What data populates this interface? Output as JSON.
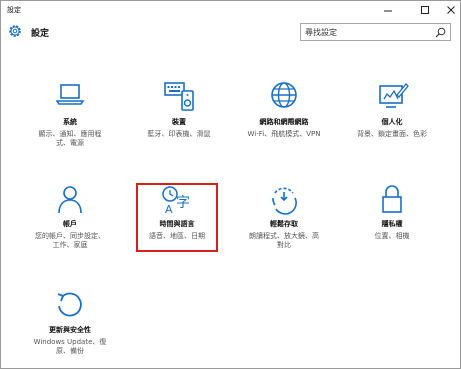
{
  "window": {
    "title": "設定"
  },
  "header": {
    "title": "設定",
    "search_placeholder": "尋找設定"
  },
  "tiles": [
    {
      "name": "系統",
      "desc_line1": "顯示、通知、應用程",
      "desc_line2": "式、電源",
      "icon": "laptop-icon"
    },
    {
      "name": "裝置",
      "desc_line1": "藍牙、印表機、滑鼠",
      "desc_line2": "",
      "icon": "devices-icon"
    },
    {
      "name": "網路和網際網路",
      "desc_line1": "Wi-Fi、飛航模式、VPN",
      "desc_line2": "",
      "icon": "globe-icon"
    },
    {
      "name": "個人化",
      "desc_line1": "背景、鎖定畫面、色彩",
      "desc_line2": "",
      "icon": "personalization-icon"
    },
    {
      "name": "帳戶",
      "desc_line1": "您的帳戶、同步設定、",
      "desc_line2": "工作、家庭",
      "icon": "person-icon"
    },
    {
      "name": "時間與語言",
      "desc_line1": "語音、地區、日期",
      "desc_line2": "",
      "icon": "time-language-icon"
    },
    {
      "name": "輕鬆存取",
      "desc_line1": "朗讀程式、放大鏡、高",
      "desc_line2": "對比",
      "icon": "ease-of-access-icon"
    },
    {
      "name": "隱私權",
      "desc_line1": "位置、相機",
      "desc_line2": "",
      "icon": "lock-icon"
    },
    {
      "name": "更新與安全性",
      "desc_line1": "Windows Update、復",
      "desc_line2": "原、備份",
      "icon": "update-icon"
    }
  ],
  "colors": {
    "accent": "#1a6fc2",
    "highlight": "#d32020"
  }
}
